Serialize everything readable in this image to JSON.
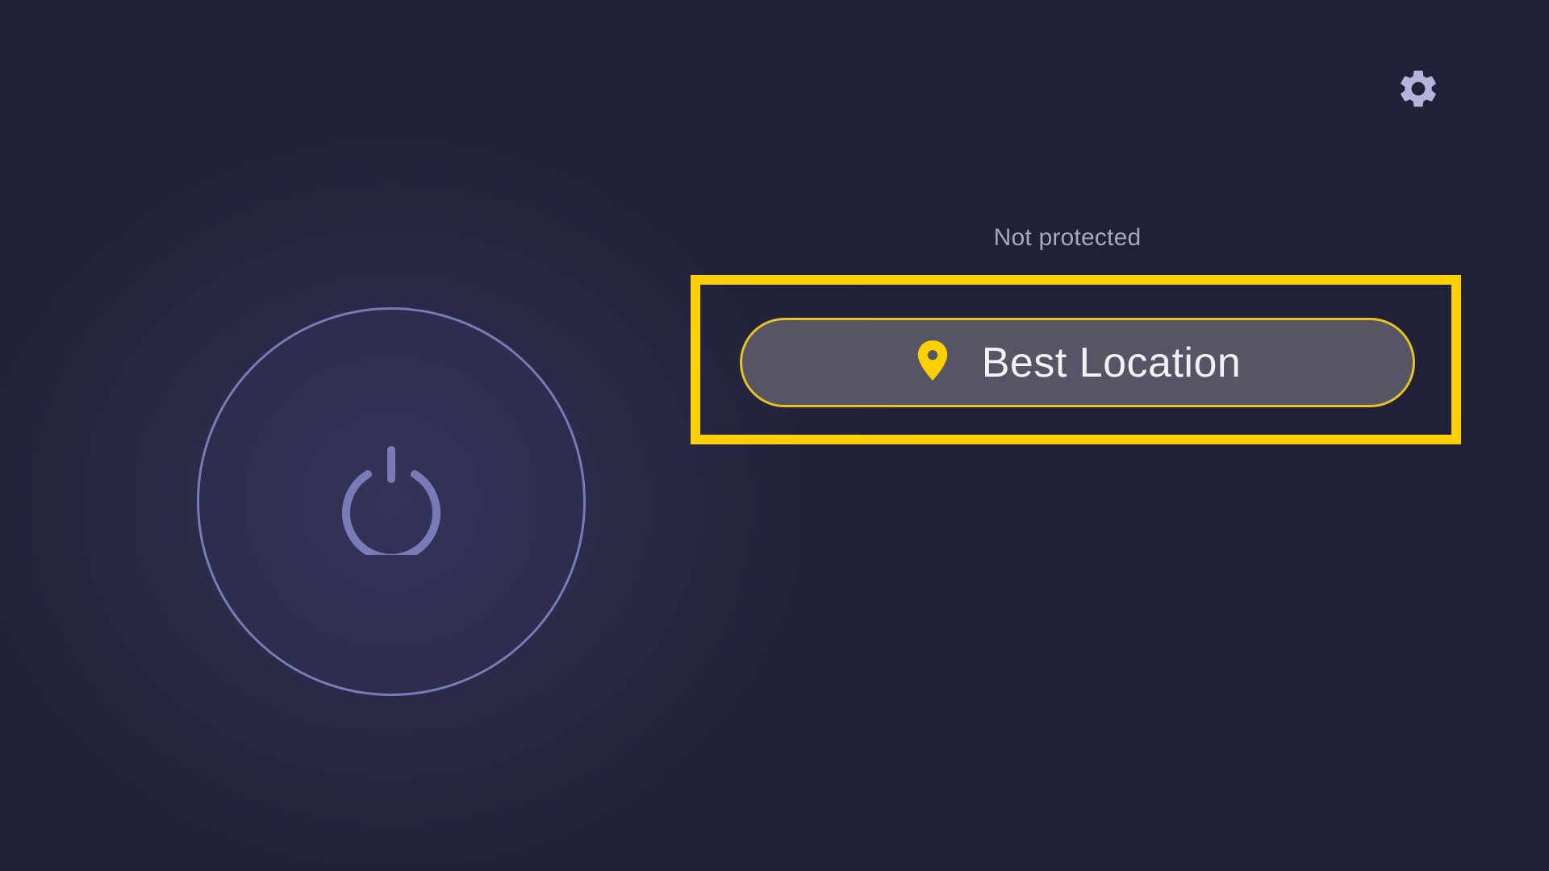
{
  "header": {
    "settings_icon": "gear-icon"
  },
  "connection": {
    "status_text": "Not protected",
    "power_icon": "power-icon",
    "ring_color": "#7a7ab8"
  },
  "location": {
    "label": "Best Location",
    "icon": "map-pin-icon",
    "accent_color": "#ffd000"
  }
}
